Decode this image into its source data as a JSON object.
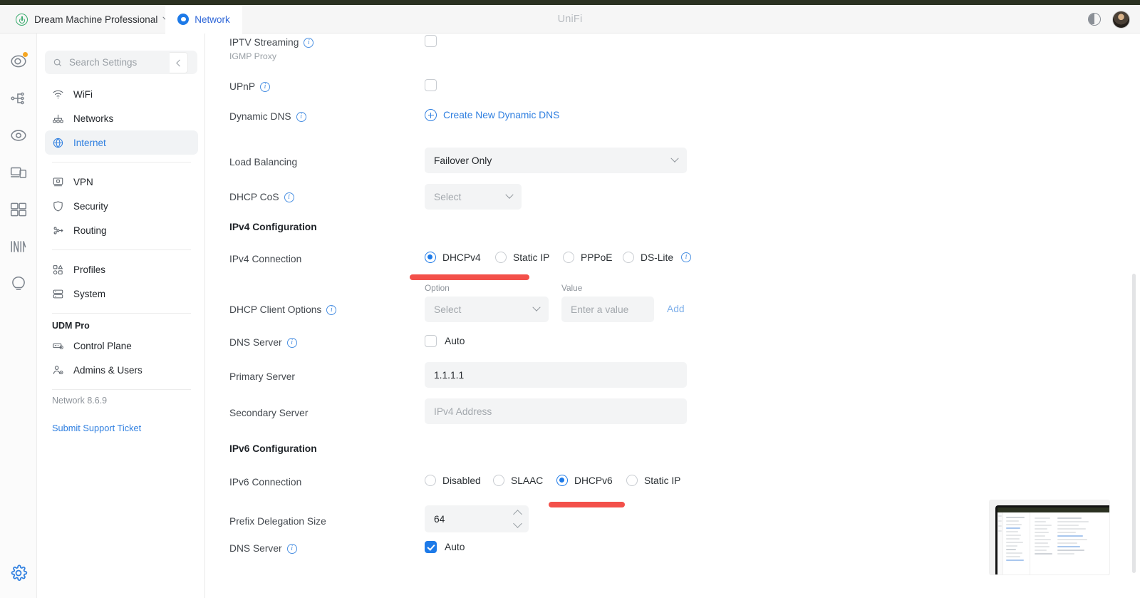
{
  "header": {
    "console_name": "Dream Machine Professional",
    "console_dropdown_icon": "chevron-down-icon",
    "console_status_icon": "power-circle-icon",
    "app_tab": "Network",
    "app_tab_icon": "network-circle-icon",
    "brand": "UniFi",
    "contrast_icon": "contrast-toggle-icon",
    "avatar_icon": "user-avatar"
  },
  "rail": {
    "items": [
      {
        "name": "dashboard-icon",
        "badge": true
      },
      {
        "name": "topology-icon",
        "badge": false
      },
      {
        "name": "devices-icon",
        "badge": false
      },
      {
        "name": "client-devices-icon",
        "badge": false
      },
      {
        "name": "apps-grid-icon",
        "badge": false
      },
      {
        "name": "insights-icon",
        "badge": false
      },
      {
        "name": "hotspot-icon",
        "badge": false
      }
    ],
    "gear": "settings-gear-icon"
  },
  "sidebar": {
    "search_placeholder": "Search Settings",
    "search_icon": "search-icon",
    "collapse_icon": "chevron-left-icon",
    "groups": [
      {
        "items": [
          {
            "label": "WiFi",
            "icon": "wifi-icon",
            "active": false
          },
          {
            "label": "Networks",
            "icon": "networks-icon",
            "active": false
          },
          {
            "label": "Internet",
            "icon": "globe-icon",
            "active": true
          }
        ]
      },
      {
        "items": [
          {
            "label": "VPN",
            "icon": "vpn-icon",
            "active": false
          },
          {
            "label": "Security",
            "icon": "shield-icon",
            "active": false
          },
          {
            "label": "Routing",
            "icon": "routing-icon",
            "active": false
          }
        ]
      },
      {
        "items": [
          {
            "label": "Profiles",
            "icon": "profiles-icon",
            "active": false
          },
          {
            "label": "System",
            "icon": "system-icon",
            "active": false
          }
        ]
      },
      {
        "title": "UDM Pro",
        "items": [
          {
            "label": "Control Plane",
            "icon": "control-plane-icon",
            "active": false
          },
          {
            "label": "Admins & Users",
            "icon": "admins-users-icon",
            "active": false
          }
        ]
      }
    ],
    "version": "Network 8.6.9",
    "support_link": "Submit Support Ticket"
  },
  "form": {
    "iptv": {
      "label": "IPTV Streaming",
      "sublabel": "IGMP Proxy",
      "info_icon": "info-icon",
      "checked": false
    },
    "upnp": {
      "label": "UPnP",
      "info_icon": "info-icon",
      "checked": false
    },
    "dynamic_dns": {
      "label": "Dynamic DNS",
      "info_icon": "info-icon",
      "action_label": "Create New Dynamic DNS",
      "action_icon": "plus-circle-icon"
    },
    "load_balancing": {
      "label": "Load Balancing",
      "value": "Failover Only",
      "chevron_icon": "chevron-down-icon"
    },
    "dhcp_cos": {
      "label": "DHCP CoS",
      "info_icon": "info-icon",
      "placeholder": "Select",
      "chevron_icon": "chevron-down-icon"
    },
    "ipv4_section_title": "IPv4 Configuration",
    "ipv4_connection": {
      "label": "IPv4 Connection",
      "options": [
        "DHCPv4",
        "Static IP",
        "PPPoE",
        "DS-Lite"
      ],
      "selected": "DHCPv4",
      "info_icon": "info-icon"
    },
    "dhcp_client_options": {
      "label": "DHCP Client Options",
      "info_icon": "info-icon",
      "option_field_label": "Option",
      "option_placeholder": "Select",
      "value_field_label": "Value",
      "value_placeholder": "Enter a value",
      "add_label": "Add"
    },
    "dns_server_v4": {
      "label": "DNS Server",
      "info_icon": "info-icon",
      "auto_label": "Auto",
      "auto_checked": false
    },
    "primary_server": {
      "label": "Primary Server",
      "value": "1.1.1.1"
    },
    "secondary_server": {
      "label": "Secondary Server",
      "placeholder": "IPv4 Address"
    },
    "ipv6_section_title": "IPv6 Configuration",
    "ipv6_connection": {
      "label": "IPv6 Connection",
      "options": [
        "Disabled",
        "SLAAC",
        "DHCPv6",
        "Static IP"
      ],
      "selected": "DHCPv6"
    },
    "prefix_delegation": {
      "label": "Prefix Delegation Size",
      "value": "64",
      "stepper_icon": "spinner-arrows-icon"
    },
    "dns_server_v6": {
      "label": "DNS Server",
      "info_icon": "info-icon",
      "auto_label": "Auto",
      "auto_checked": true
    }
  },
  "annotations": {
    "highlight_color": "#f3504a",
    "bars": [
      {
        "target": "DHCPv4"
      },
      {
        "target": "DHCPv6"
      }
    ]
  },
  "pip": {
    "name": "screen-share-thumbnail"
  }
}
